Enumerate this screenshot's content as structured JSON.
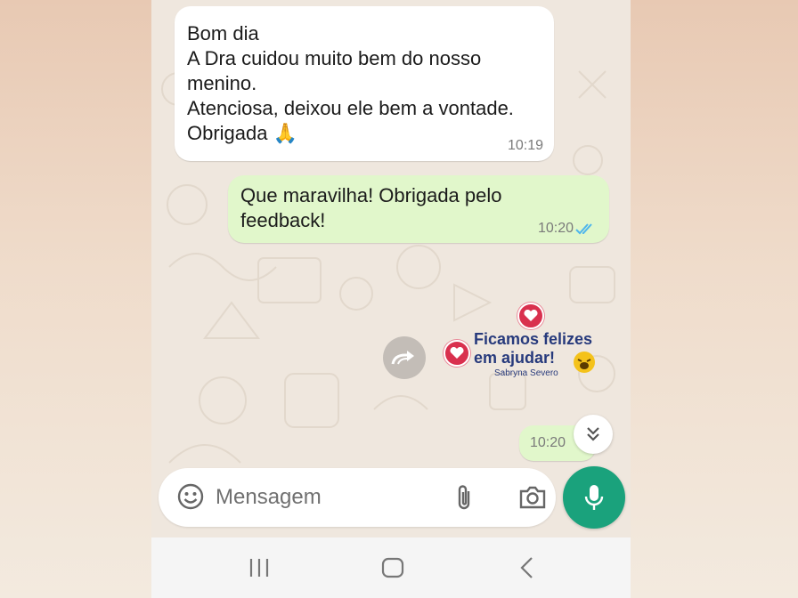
{
  "conversation": {
    "messages": [
      {
        "direction": "incoming",
        "text": "Bom dia\nA Dra cuidou muito bem do nosso\nmenino.\nAtenciosa, deixou ele bem a vontade.\nObrigada",
        "emoji": "🙏",
        "time": "10:19"
      },
      {
        "direction": "outgoing",
        "text": "Que maravilha! Obrigada pelo\nfeedback!",
        "time": "10:20",
        "status": "read"
      },
      {
        "direction": "outgoing",
        "type": "sticker",
        "sticker_line1": "Ficamos felizes",
        "sticker_line2": "em ajudar!",
        "sticker_brand": "Sabryna Severo",
        "time": "10:20"
      }
    ]
  },
  "composer": {
    "placeholder": "Mensagem"
  },
  "colors": {
    "incoming_bubble": "#ffffff",
    "outgoing_bubble": "#e1f7cb",
    "accent": "#1aa27c",
    "read_ticks": "#4fb6ec"
  },
  "icons": [
    "forward-icon",
    "double-chevron-down-icon",
    "emoji-icon",
    "attach-icon",
    "camera-icon",
    "mic-icon",
    "recent-apps-icon",
    "home-icon",
    "back-icon"
  ]
}
